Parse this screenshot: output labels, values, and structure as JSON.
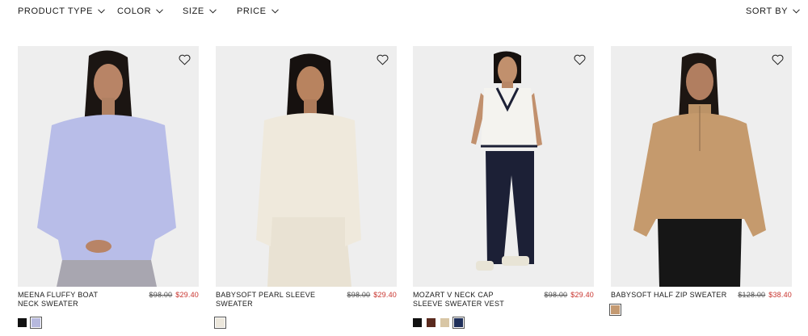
{
  "filters": {
    "product_type": "PRODUCT TYPE",
    "color": "COLOR",
    "size": "SIZE",
    "price": "PRICE",
    "sort_by": "SORT BY"
  },
  "products": [
    {
      "name": "MEENA FLUFFY BOAT NECK SWEATER",
      "original_price": "$98.00",
      "sale_price": "$29.40",
      "swatches": [
        "#111111",
        "#b7b9de"
      ],
      "garment_color": "#b8bde8",
      "bottom_color": "#a8a6b0"
    },
    {
      "name": "BABYSOFT PEARL SLEEVE SWEATER",
      "original_price": "$98.00",
      "sale_price": "$29.40",
      "swatches": [
        "#ece7dc"
      ],
      "garment_color": "#efe9dc",
      "bottom_color": "#e9e2d3"
    },
    {
      "name": "MOZART V NECK CAP SLEEVE SWEATER VEST",
      "original_price": "$98.00",
      "sale_price": "$29.40",
      "swatches": [
        "#111111",
        "#5a2a1e",
        "#d8c6a5",
        "#1f2f5a"
      ],
      "garment_color": "#f4f3ef",
      "bottom_color": "#1c2036"
    },
    {
      "name": "BABYSOFT HALF ZIP SWEATER",
      "original_price": "$128.00",
      "sale_price": "$38.40",
      "swatches": [
        "#c49a72"
      ],
      "garment_color": "#c59a6d",
      "bottom_color": "#161616"
    }
  ]
}
